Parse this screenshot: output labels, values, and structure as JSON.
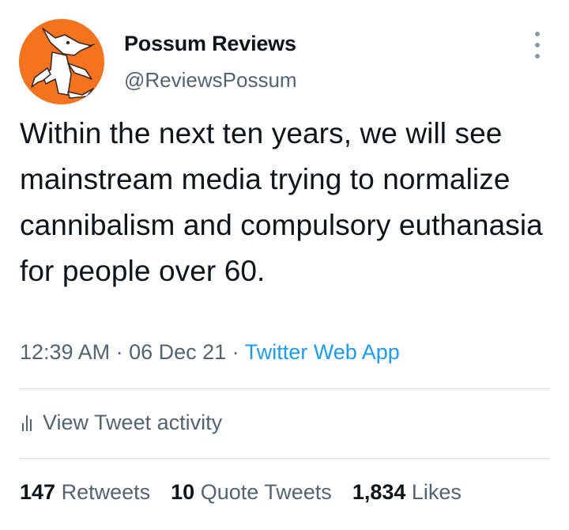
{
  "author": {
    "display_name": "Possum Reviews",
    "handle": "@ReviewsPossum",
    "avatar_icon": "possum-avatar",
    "avatar_color": "#f4731f"
  },
  "more_icon": "more-vertical-icon",
  "tweet": {
    "text": "Within the next ten years, we will see mainstream media trying to normalize cannibalism and compulsory euthanasia for people over 60."
  },
  "meta": {
    "time": "12:39 AM",
    "separator1": " · ",
    "date": "06 Dec 21",
    "separator2": " · ",
    "source": "Twitter Web App"
  },
  "activity": {
    "icon": "analytics-bars-icon",
    "label": "View Tweet activity"
  },
  "stats": {
    "retweets": {
      "count": "147",
      "label": "Retweets"
    },
    "quotes": {
      "count": "10",
      "label": "Quote Tweets"
    },
    "likes": {
      "count": "1,834",
      "label": "Likes"
    }
  },
  "colors": {
    "text_primary": "#0f1419",
    "text_secondary": "#536471",
    "link": "#1d9bf0",
    "divider": "#cfd9de"
  }
}
